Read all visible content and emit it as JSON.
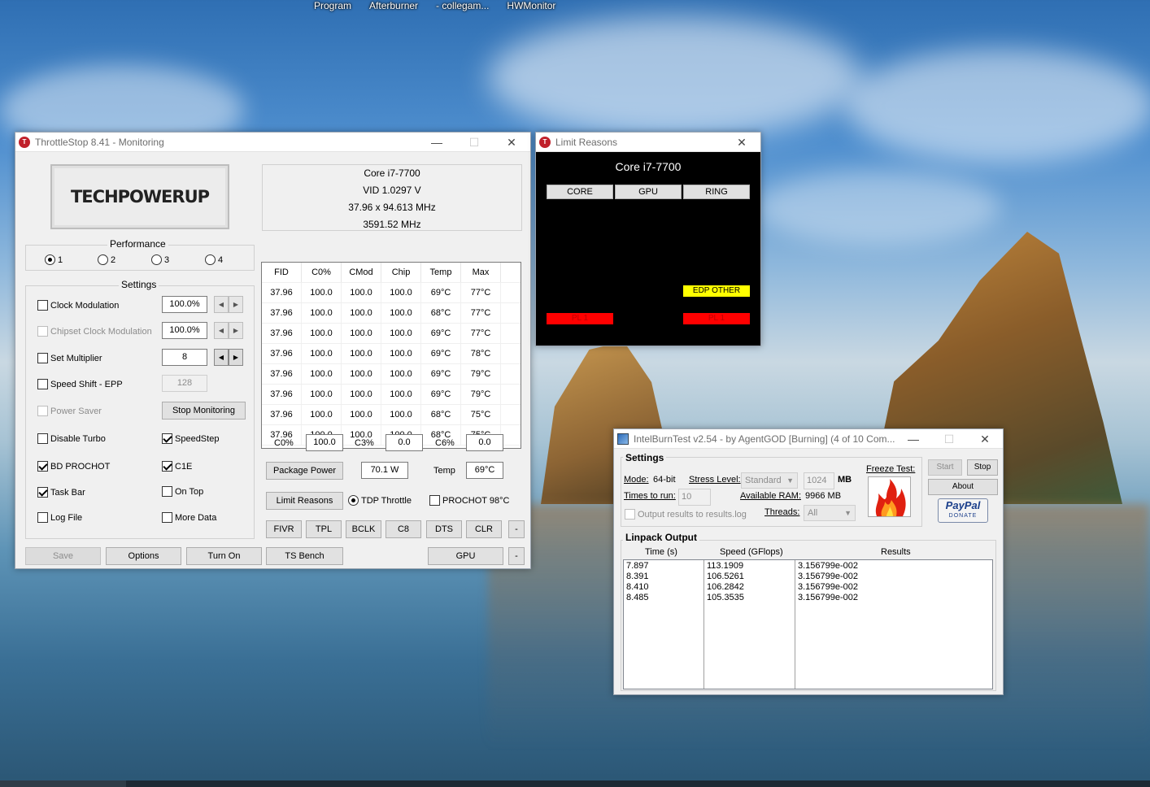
{
  "desktop": {
    "labels": [
      "Program",
      "Afterburner",
      "- collegam...",
      "HWMonitor"
    ]
  },
  "throttlestop": {
    "title": "ThrottleStop 8.41 - Monitoring",
    "logo_text": "TECHPOWERUP",
    "cpu": {
      "name": "Core i7-7700",
      "vid": "VID  1.0297 V",
      "multiplier": "37.96 x 94.613 MHz",
      "freq": "3591.52 MHz"
    },
    "performance": {
      "label": "Performance",
      "options": [
        "1",
        "2",
        "3",
        "4"
      ],
      "selected": "1"
    },
    "settings": {
      "label": "Settings",
      "clock_modulation": {
        "label": "Clock Modulation",
        "value": "100.0%",
        "checked": false
      },
      "chipset_clock_modulation": {
        "label": "Chipset Clock Modulation",
        "value": "100.0%",
        "checked": false
      },
      "set_multiplier": {
        "label": "Set Multiplier",
        "value": "8",
        "checked": false
      },
      "speed_shift": {
        "label": "Speed Shift - EPP",
        "value": "128",
        "checked": false
      },
      "power_saver": {
        "label": "Power Saver",
        "checked": false
      },
      "stop_monitoring": "Stop Monitoring",
      "disable_turbo": {
        "label": "Disable Turbo",
        "checked": false
      },
      "speedstep": {
        "label": "SpeedStep",
        "checked": true
      },
      "bd_prochot": {
        "label": "BD PROCHOT",
        "checked": true
      },
      "c1e": {
        "label": "C1E",
        "checked": true
      },
      "task_bar": {
        "label": "Task Bar",
        "checked": true
      },
      "on_top": {
        "label": "On Top",
        "checked": false
      },
      "log_file": {
        "label": "Log File",
        "checked": false
      },
      "more_data": {
        "label": "More Data",
        "checked": false
      }
    },
    "table": {
      "headers": [
        "FID",
        "C0%",
        "CMod",
        "Chip",
        "Temp",
        "Max"
      ],
      "rows": [
        [
          "37.96",
          "100.0",
          "100.0",
          "100.0",
          "69°C",
          "77°C"
        ],
        [
          "37.96",
          "100.0",
          "100.0",
          "100.0",
          "68°C",
          "77°C"
        ],
        [
          "37.96",
          "100.0",
          "100.0",
          "100.0",
          "69°C",
          "77°C"
        ],
        [
          "37.96",
          "100.0",
          "100.0",
          "100.0",
          "69°C",
          "78°C"
        ],
        [
          "37.96",
          "100.0",
          "100.0",
          "100.0",
          "69°C",
          "79°C"
        ],
        [
          "37.96",
          "100.0",
          "100.0",
          "100.0",
          "69°C",
          "79°C"
        ],
        [
          "37.96",
          "100.0",
          "100.0",
          "100.0",
          "68°C",
          "75°C"
        ],
        [
          "37.96",
          "100.0",
          "100.0",
          "100.0",
          "68°C",
          "75°C"
        ]
      ]
    },
    "cstates": {
      "c0_label": "C0%",
      "c0_value": "100.0",
      "c3_label": "C3%",
      "c3_value": "0.0",
      "c6_label": "C6%",
      "c6_value": "0.0"
    },
    "package_power": {
      "button": "Package Power",
      "value": "70.1 W",
      "temp_label": "Temp",
      "temp_value": "69°C"
    },
    "limit_reasons_button": "Limit Reasons",
    "tdp_throttle": {
      "label": "TDP Throttle",
      "checked": true
    },
    "prochot": {
      "label": "PROCHOT 98°C",
      "checked": false
    },
    "tool_buttons": [
      "FIVR",
      "TPL",
      "BCLK",
      "C8",
      "DTS",
      "CLR",
      "-"
    ],
    "bottom_buttons": {
      "save": "Save",
      "options": "Options",
      "turn_on": "Turn On",
      "ts_bench": "TS Bench",
      "gpu": "GPU",
      "minus": "-"
    }
  },
  "limit_reasons": {
    "title": "Limit Reasons",
    "cpu": "Core i7-7700",
    "columns": [
      "CORE",
      "GPU",
      "RING"
    ],
    "edp_other": "EDP OTHER",
    "pl1_left": "PL 1",
    "pl1_right": "PL 1"
  },
  "intelburntest": {
    "title": "IntelBurnTest v2.54 - by AgentGOD [Burning] (4 of 10 Com...",
    "settings_label": "Settings",
    "mode_label": "Mode:",
    "mode_value": "64-bit",
    "stress_label": "Stress Level:",
    "stress_value": "Standard",
    "mem_value": "1024",
    "mem_unit": "MB",
    "times_label": "Times to run:",
    "times_value": "10",
    "avail_label": "Available RAM:",
    "avail_value": "9966 MB",
    "output_log": "Output results to results.log",
    "threads_label": "Threads:",
    "threads_value": "All",
    "freeze_label": "Freeze Test:",
    "start": "Start",
    "stop": "Stop",
    "about": "About",
    "paypal": "PayPal",
    "donate": "DONATE",
    "linpack_label": "Linpack Output",
    "headers": [
      "Time (s)",
      "Speed (GFlops)",
      "Results"
    ],
    "times": [
      "7.897",
      "8.391",
      "8.410",
      "8.485"
    ],
    "speeds": [
      "113.1909",
      "106.5261",
      "106.2842",
      "105.3535"
    ],
    "results": [
      "3.156799e-002",
      "3.156799e-002",
      "3.156799e-002",
      "3.156799e-002"
    ]
  }
}
